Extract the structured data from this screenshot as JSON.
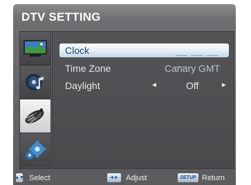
{
  "screen": {
    "title": "DTV SETTING"
  },
  "sidebar": {
    "items": [
      {
        "icon": "tv-screen-icon",
        "active": false
      },
      {
        "icon": "audio-disc-icon",
        "active": false
      },
      {
        "icon": "satellite-dish-icon",
        "active": true
      },
      {
        "icon": "settings-gears-icon",
        "active": false
      }
    ]
  },
  "menu": {
    "rows": [
      {
        "label": "Clock",
        "value": "__ __  __ __",
        "selected": true
      },
      {
        "label": "Time Zone",
        "value": "Canary GMT",
        "selected": false
      },
      {
        "label": "Daylight",
        "value": "Off",
        "left_arrow": "◄",
        "right_arrow": "►",
        "selected": false
      }
    ]
  },
  "footer": {
    "select_key": "▲▼",
    "select_label": "Select",
    "adjust_key": "◄►",
    "adjust_label": "Adjust",
    "return_key": "SETUP",
    "return_label": "Return"
  },
  "colors": {
    "panel": "#6a6a6d",
    "highlight": "#e3eef6",
    "highlight_text": "#1f3a70"
  }
}
